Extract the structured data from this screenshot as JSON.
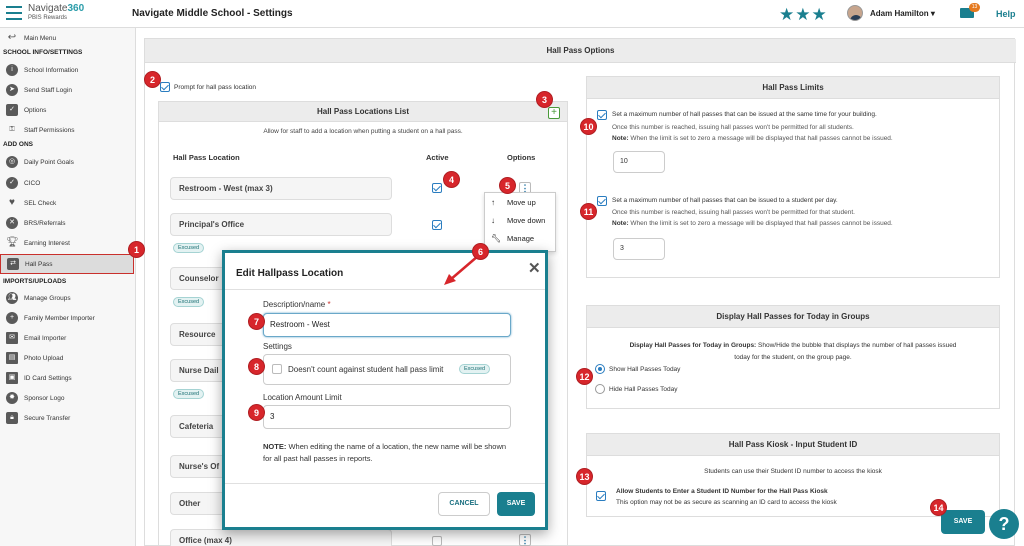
{
  "brand": {
    "name_part1": "Navigate",
    "name_part2": "360",
    "sub": "PBIS Rewards"
  },
  "header": {
    "title": "Navigate Middle School - Settings",
    "user": "Adam Hamilton",
    "mail_count": "13",
    "help": "Help",
    "stars": "★★★"
  },
  "sidebar": {
    "main_menu": "Main Menu",
    "section1": "SCHOOL INFO/SETTINGS",
    "items1": [
      "School Information",
      "Send Staff Login",
      "Options",
      "Staff Permissions"
    ],
    "section2": "ADD ONS",
    "items2": [
      "Daily Point Goals",
      "CICO",
      "SEL Check",
      "BRS/Referrals",
      "Earning Interest",
      "Hall Pass"
    ],
    "section3": "IMPORTS/UPLOADS",
    "items3": [
      "Manage Groups",
      "Family Member Importer",
      "Email Importer",
      "Photo Upload",
      "ID Card Settings",
      "Sponsor Logo",
      "Secure Transfer"
    ]
  },
  "main": {
    "header": "Hall Pass Options",
    "prompt_label": "Prompt for hall pass location",
    "locations": {
      "title": "Hall Pass Locations List",
      "subtitle": "Allow for staff to add a location when putting a student on a hall pass.",
      "col_location": "Hall Pass Location",
      "col_active": "Active",
      "col_options": "Options",
      "rows": [
        "Restroom - West (max 3)",
        "Principal's Office",
        "Counselor",
        "Resource",
        "Nurse Dail",
        "Cafeteria",
        "Nurse's Of",
        "Other",
        "Office (max 4)"
      ],
      "excused_tag": "Excused"
    },
    "options_menu": [
      "Move up",
      "Move down",
      "Manage"
    ],
    "save": "SAVE"
  },
  "limits": {
    "title": "Hall Pass Limits",
    "opt1": "Set a maximum number of hall passes that can be issued at the same time for your building.",
    "opt1_sub": "Once this number is reached, issuing hall passes won't be permitted for all students.",
    "note_label": "Note:",
    "note_text": "When the limit is set to zero a message will be displayed that hall passes cannot be issued.",
    "opt1_value": "10",
    "opt2": "Set a maximum number of hall passes that can be issued to a student per day.",
    "opt2_sub": "Once this number is reached, issuing hall passes won't be permitted for that student.",
    "opt2_value": "3"
  },
  "groups": {
    "title": "Display Hall Passes for Today in Groups",
    "desc_bold": "Display Hall Passes for Today in Groups:",
    "desc_line1": "Show/Hide the bubble that displays the number of hall passes issued",
    "desc_line2": "today for the student, on the group page.",
    "show": "Show Hall Passes Today",
    "hide": "Hide Hall Passes Today"
  },
  "kiosk": {
    "title": "Hall Pass Kiosk - Input Student ID",
    "desc": "Students can use their Student ID number to access the kiosk",
    "opt_bold": "Allow Students to Enter a Student ID Number for the Hall Pass Kiosk",
    "opt_sub": "This option may not be as secure as scanning an ID card to access the kiosk"
  },
  "modal": {
    "title": "Edit Hallpass Location",
    "desc_label": "Description/name",
    "required_mark": "*",
    "desc_value": "Restroom - West",
    "settings_label": "Settings",
    "settings_option": "Doesn't count against student hall pass limit",
    "settings_tag": "Excused",
    "limit_label": "Location Amount Limit",
    "limit_value": "3",
    "note_bold": "NOTE:",
    "note_text": "When editing the name of a location, the new name will be shown for all past hall passes in reports.",
    "cancel": "CANCEL",
    "save": "SAVE"
  },
  "callouts": [
    "1",
    "2",
    "3",
    "4",
    "5",
    "6",
    "7",
    "8",
    "9",
    "10",
    "11",
    "12",
    "13",
    "14"
  ],
  "colors": {
    "accent": "#1a7f8f",
    "callout": "#d7262b",
    "active_border": "#c9302c"
  }
}
